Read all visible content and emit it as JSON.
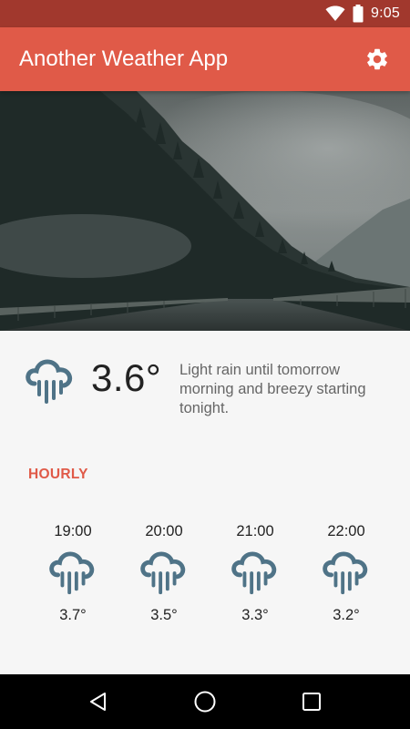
{
  "status_bar": {
    "time": "9:05",
    "icons": [
      "wifi-icon",
      "battery-icon"
    ]
  },
  "app_bar": {
    "title": "Another Weather App",
    "settings_icon": "gear-icon"
  },
  "current": {
    "icon": "rain-cloud-icon",
    "temperature": "3.6°",
    "summary": "Light rain until tomorrow morning and breezy starting tonight."
  },
  "hourly": {
    "heading": "HOURLY",
    "items": [
      {
        "time": "19:00",
        "icon": "rain-cloud-icon",
        "temp": "3.7°"
      },
      {
        "time": "20:00",
        "icon": "rain-cloud-icon",
        "temp": "3.5°"
      },
      {
        "time": "21:00",
        "icon": "rain-cloud-icon",
        "temp": "3.3°"
      },
      {
        "time": "22:00",
        "icon": "rain-cloud-icon",
        "temp": "3.2°"
      }
    ]
  },
  "nav_bar": {
    "buttons": [
      "back-icon",
      "home-icon",
      "recents-icon"
    ]
  },
  "colors": {
    "status_bar": "#a1382d",
    "app_bar": "#e05a48",
    "accent": "#e05a48",
    "icon": "#4f7387"
  }
}
